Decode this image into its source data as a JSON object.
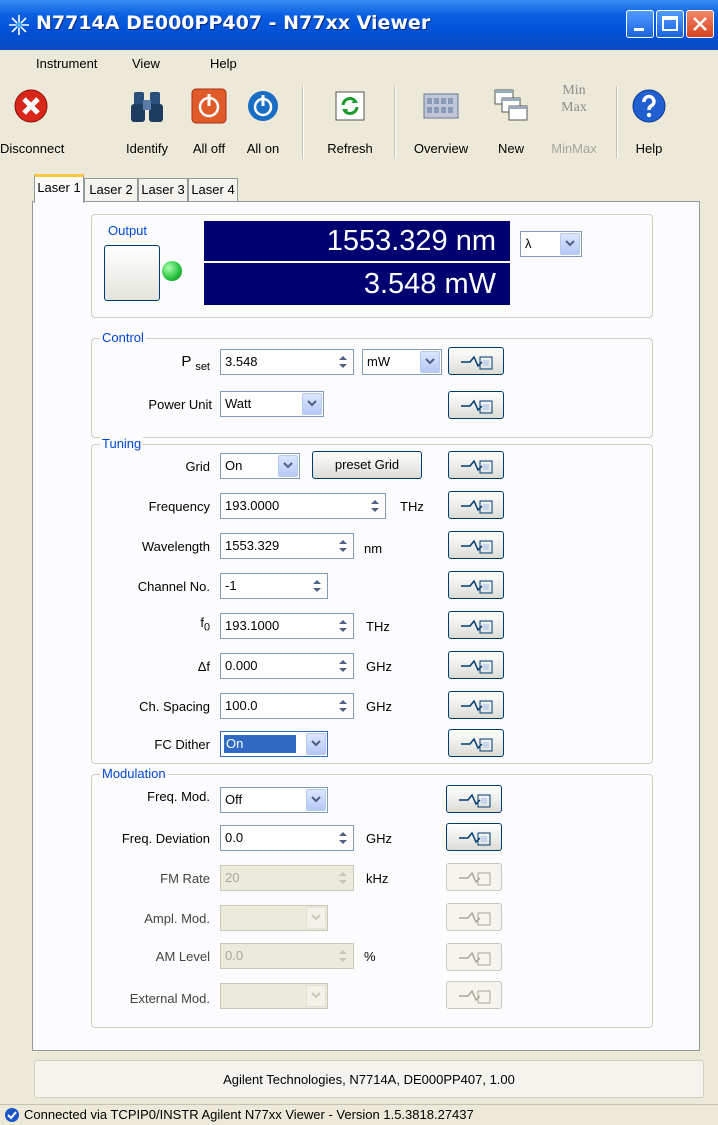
{
  "window": {
    "title": "N7714A DE000PP407 - N77xx Viewer"
  },
  "menu": [
    "Instrument",
    "View",
    "Help"
  ],
  "toolbar": {
    "disconnect": "Disconnect",
    "identify": "Identify",
    "all_off": "All off",
    "all_on": "All on",
    "refresh": "Refresh",
    "overview": "Overview",
    "new": "New",
    "minmax": "MinMax",
    "minmax_icon_top": "Min",
    "minmax_icon_bottom": "Max",
    "help": "Help"
  },
  "tabs": [
    "Laser 1",
    "Laser 2",
    "Laser 3",
    "Laser 4"
  ],
  "output": {
    "label": "Output",
    "wavelength_display": "1553.329 nm",
    "power_display": "3.548 mW",
    "unit_select": "λ"
  },
  "control": {
    "label": "Control",
    "pset_label": "P",
    "pset_sub": "set",
    "pset_value": "3.548",
    "pset_unit": "mW",
    "power_unit_label": "Power Unit",
    "power_unit_value": "Watt"
  },
  "tuning": {
    "label": "Tuning",
    "grid_label": "Grid",
    "grid_value": "On",
    "preset_grid": "preset Grid",
    "frequency_label": "Frequency",
    "frequency_value": "193.0000",
    "frequency_unit": "THz",
    "wavelength_label": "Wavelength",
    "wavelength_value": "1553.329",
    "wavelength_unit": "nm",
    "channel_label": "Channel No.",
    "channel_value": "-1",
    "f0_label": "f",
    "f0_sub": "0",
    "f0_value": "193.1000",
    "f0_unit": "THz",
    "df_label": "Δf",
    "df_value": "0.000",
    "df_unit": "GHz",
    "spacing_label": "Ch. Spacing",
    "spacing_value": "100.0",
    "spacing_unit": "GHz",
    "dither_label": "FC Dither",
    "dither_value": "On"
  },
  "modulation": {
    "label": "Modulation",
    "freq_mod_label": "Freq. Mod.",
    "freq_mod_value": "Off",
    "freq_dev_label": "Freq. Deviation",
    "freq_dev_value": "0.0",
    "freq_dev_unit": "GHz",
    "fm_rate_label": "FM Rate",
    "fm_rate_value": "20",
    "fm_rate_unit": "kHz",
    "ampl_mod_label": "Ampl. Mod.",
    "ampl_mod_value": "",
    "am_level_label": "AM Level",
    "am_level_value": "0.0",
    "am_level_unit": "%",
    "ext_mod_label": "External Mod.",
    "ext_mod_value": ""
  },
  "info": "Agilent Technologies, N7714A, DE000PP407, 1.00",
  "status": "Connected via TCPIP0/INSTR  Agilent N77xx Viewer - Version 1.5.3818.27437",
  "colors": {
    "display_bg": "#000070",
    "title_bar": "#0052d6",
    "group_label": "#0046d5",
    "led": "#22c03a"
  }
}
